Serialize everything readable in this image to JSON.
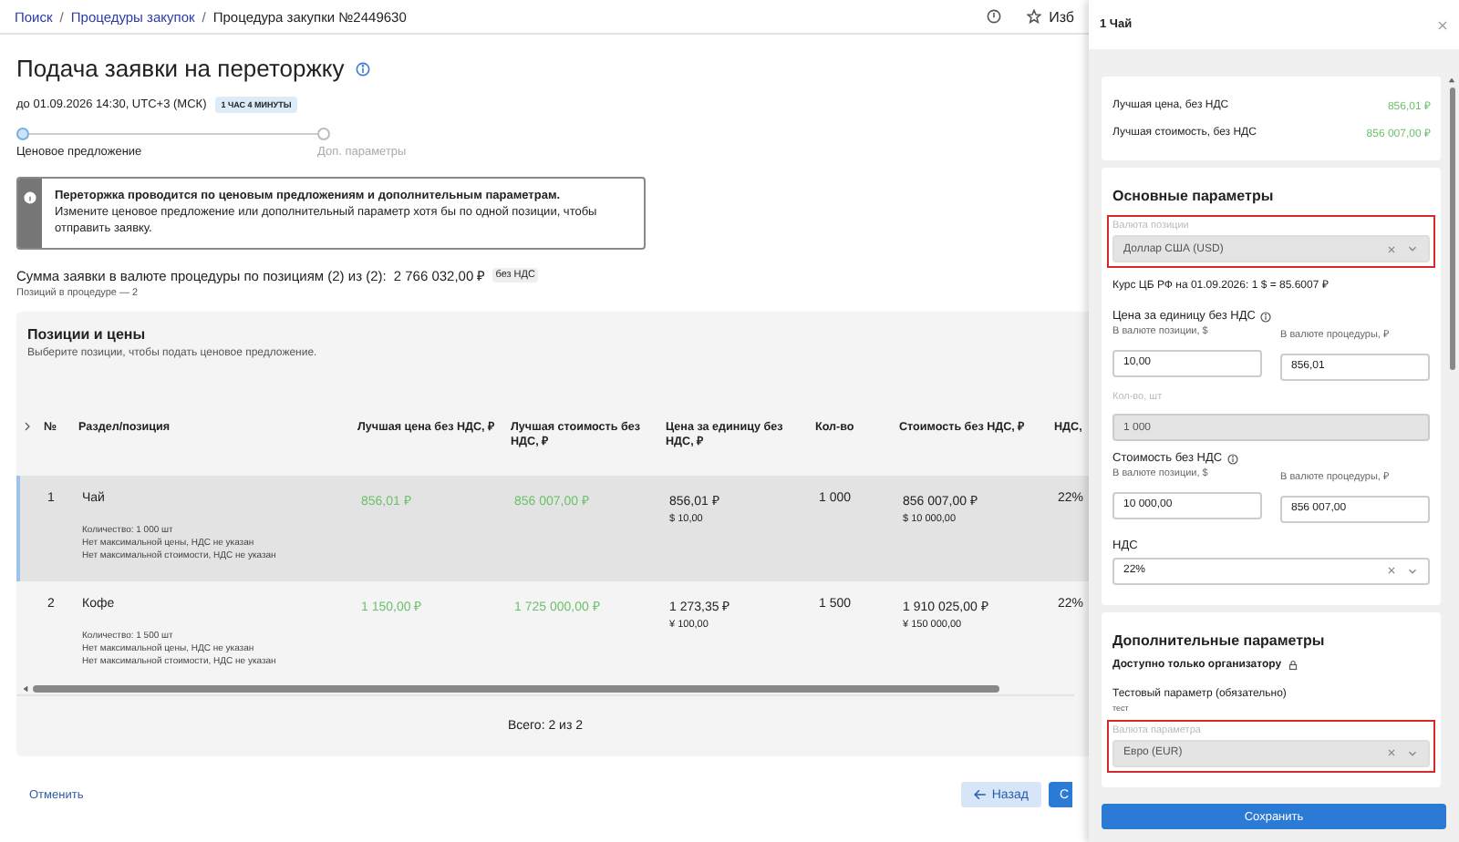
{
  "breadcrumb_separator": "/",
  "breadcrumbs": [
    {
      "label": "Поиск",
      "link": true
    },
    {
      "label": "Процедуры закупок",
      "link": true
    },
    {
      "label": "Процедура закупки №2449630",
      "link": false
    }
  ],
  "header_action": "Изб",
  "title": "Подача заявки на переторжку",
  "deadline": "до 01.09.2026 14:30, UTC+3 (МСК)",
  "timer": "1 ЧАС 4 МИНУТЫ",
  "steps": [
    {
      "label": "Ценовое предложение",
      "selected": true
    },
    {
      "label": "Доп. параметры",
      "selected": false
    }
  ],
  "alert": {
    "title": "Переторжка проводится по ценовым предложениям и дополнительным параметрам.",
    "text": "Измените ценовое предложение или дополнительный параметр хотя бы по одной позиции, чтобы отправить заявку."
  },
  "sum": {
    "label": "Сумма заявки в валюте процедуры по позициям (2) из (2):",
    "value": "2 766 032,00 ₽",
    "tag": "без НДС",
    "note": "Позиций в процедуре — 2"
  },
  "table": {
    "title": "Позиции и цены",
    "subtitle": "Выберите позиции, чтобы подать ценовое предложение.",
    "columns": [
      "№",
      "Раздел/позиция",
      "Лучшая цена без НДС, ₽",
      "Лучшая стоимость без НДС, ₽",
      "Цена за единицу без НДС, ₽",
      "Кол-во",
      "Стоимость без НДС, ₽",
      "НДС,"
    ],
    "rows": [
      {
        "selected": true,
        "no": "1",
        "name": "Чай",
        "details": [
          "Количество: 1 000 шт",
          "Нет максимальной цены, НДС не указан",
          "Нет максимальной стоимости, НДС не указан"
        ],
        "best_price": "856,01 ₽",
        "best_cost": "856 007,00 ₽",
        "unit_price": "856,01 ₽",
        "unit_price_cur": "$ 10,00",
        "qty": "1 000",
        "cost": "856 007,00 ₽",
        "cost_cur": "$ 10 000,00",
        "vat": "22%"
      },
      {
        "selected": false,
        "no": "2",
        "name": "Кофе",
        "details": [
          "Количество: 1 500 шт",
          "Нет максимальной цены, НДС не указан",
          "Нет максимальной стоимости, НДС не указан"
        ],
        "best_price": "1 150,00 ₽",
        "best_cost": "1 725 000,00 ₽",
        "unit_price": "1 273,35 ₽",
        "unit_price_cur": "¥ 100,00",
        "qty": "1 500",
        "cost": "1 910 025,00 ₽",
        "cost_cur": "¥ 150 000,00",
        "vat": "22%"
      }
    ],
    "total": "Всего: 2 из 2"
  },
  "footer": {
    "cancel": "Отменить",
    "back": "Назад",
    "submit": "С"
  },
  "drawer": {
    "title": "1 Чай",
    "summary": [
      {
        "label": "Лучшая цена, без НДС",
        "value": "856,01 ₽"
      },
      {
        "label": "Лучшая стоимость, без НДС",
        "value": "856 007,00 ₽"
      }
    ],
    "main_title": "Основные параметры",
    "currency": {
      "label": "Валюта позиции",
      "value": "Доллар США (USD)",
      "disabled": true,
      "highlighted": true
    },
    "rate": "Курс ЦБ РФ на 01.09.2026: 1 $ = 85.6007 ₽",
    "price": {
      "label": "Цена за единицу без НДС",
      "fields": [
        {
          "label": "В валюте позиции, $",
          "value": "10,00"
        },
        {
          "label": "В валюте процедуры, ₽",
          "value": "856,01"
        }
      ]
    },
    "qty": {
      "label": "Кол-во, шт",
      "value": "1 000",
      "disabled": true
    },
    "cost": {
      "label": "Стоимость без НДС",
      "fields": [
        {
          "label": "В валюте позиции, $",
          "value": "10 000,00"
        },
        {
          "label": "В валюте процедуры, ₽",
          "value": "856 007,00"
        }
      ]
    },
    "vat": {
      "label": "НДС",
      "value": "22%",
      "disabled": false,
      "highlighted": false
    },
    "extra_title": "Дополнительные параметры",
    "restricted": "Доступно только организатору",
    "param": {
      "label": "Тестовый параметр (обязательно)",
      "value": "тест"
    },
    "param_currency": {
      "label": "Валюта параметра",
      "value": "Евро (EUR)",
      "disabled": true,
      "highlighted": true
    },
    "save": "Сохранить"
  }
}
